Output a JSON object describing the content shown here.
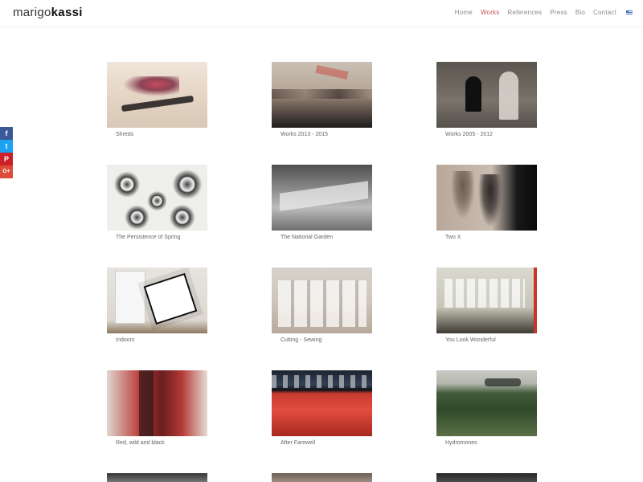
{
  "header": {
    "logo": {
      "part1": "marigo",
      "part2": "kassi"
    },
    "nav": [
      {
        "label": "Home",
        "active": false
      },
      {
        "label": "Works",
        "active": true
      },
      {
        "label": "References",
        "active": false
      },
      {
        "label": "Press",
        "active": false
      },
      {
        "label": "Bio",
        "active": false
      },
      {
        "label": "Contact",
        "active": false
      }
    ],
    "language_icon": "greek-flag-icon"
  },
  "social": [
    {
      "name": "facebook-icon",
      "glyph": "f",
      "color": "#3b5998"
    },
    {
      "name": "twitter-icon",
      "glyph": "t",
      "color": "#1da1f2"
    },
    {
      "name": "pinterest-icon",
      "glyph": "P",
      "color": "#cb2027"
    },
    {
      "name": "google-plus-icon",
      "glyph": "G+",
      "color": "#dd4b39"
    }
  ],
  "works": [
    {
      "title": "Shreds"
    },
    {
      "title": "Works 2013 - 2015"
    },
    {
      "title": "Works 2005 - 2012"
    },
    {
      "title": "The Persistence of Spring"
    },
    {
      "title": "The National Garden"
    },
    {
      "title": "Two X"
    },
    {
      "title": "Indoors"
    },
    {
      "title": "Cutting - Sewing"
    },
    {
      "title": "You Look Wonderful"
    },
    {
      "title": "Red, wild and black"
    },
    {
      "title": "After Farewell"
    },
    {
      "title": "Hydromones"
    }
  ],
  "colors": {
    "nav_active": "#c45353",
    "nav_text": "#8a8a8a",
    "caption_text": "#666666"
  }
}
